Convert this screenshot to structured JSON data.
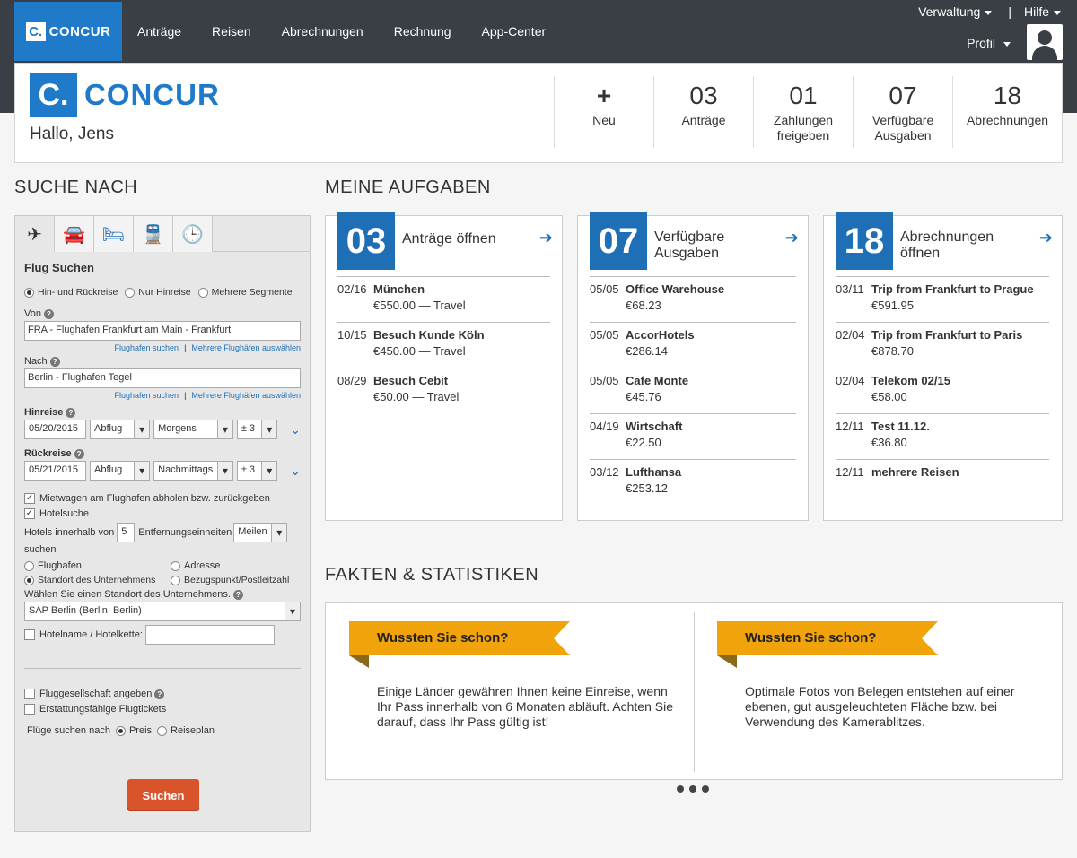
{
  "nav": {
    "logo": "CONCUR",
    "items": [
      "Anträge",
      "Reisen",
      "Abrechnungen",
      "Rechnung",
      "App-Center"
    ],
    "verwaltung": "Verwaltung",
    "sep": "|",
    "hilfe": "Hilfe",
    "profil": "Profil"
  },
  "welcome": {
    "logo": "CONCUR",
    "greeting": "Hallo, Jens",
    "tiles": [
      {
        "num": "+",
        "label": "Neu"
      },
      {
        "num": "03",
        "label": "Anträge"
      },
      {
        "num": "01",
        "label": "Zahlungen freigeben"
      },
      {
        "num": "07",
        "label": "Verfügbare Ausgaben"
      },
      {
        "num": "18",
        "label": "Abrechnungen"
      }
    ]
  },
  "search": {
    "heading": "SUCHE NACH",
    "title": "Flug Suchen",
    "trip_types": [
      "Hin- und Rückreise",
      "Nur Hinreise",
      "Mehrere Segmente"
    ],
    "von_label": "Von",
    "von_value": "FRA - Flughafen Frankfurt am Main - Frankfurt",
    "nach_label": "Nach",
    "nach_value": "Berlin - Flughafen Tegel",
    "link1": "Flughafen suchen",
    "link2": "Mehrere Flughäfen auswählen",
    "hinreise_label": "Hinreise",
    "hin_date": "05/20/2015",
    "hin_type": "Abflug",
    "hin_time": "Morgens",
    "hin_range": "± 3",
    "rueck_label": "Rückreise",
    "rueck_date": "05/21/2015",
    "rueck_type": "Abflug",
    "rueck_time": "Nachmittags",
    "rueck_range": "± 3",
    "car": "Mietwagen am Flughafen abholen bzw. zurückgeben",
    "hotel": "Hotelsuche",
    "hotel_within": "Hotels innerhalb von",
    "hotel_dist": "5",
    "dist_units": "Entfernungseinheiten",
    "dist_unit_val": "Meilen",
    "suchen_word": "suchen",
    "opt_flughafen": "Flughafen",
    "opt_adresse": "Adresse",
    "opt_standort": "Standort des Unternehmens",
    "opt_bezug": "Bezugspunkt/Postleitzahl",
    "standort_label": "Wählen Sie einen Standort des Unternehmens.",
    "standort_value": "SAP Berlin (Berlin, Berlin)",
    "hotelname": "Hotelname / Hotelkette:",
    "airline": "Fluggesellschaft angeben",
    "refund": "Erstattungsfähige Flugtickets",
    "sort_label": "Flüge suchen nach",
    "sort_price": "Preis",
    "sort_plan": "Reiseplan",
    "button": "Suchen"
  },
  "tasks": {
    "heading": "MEINE AUFGABEN",
    "cards": [
      {
        "count": "03",
        "title": "Anträge öffnen",
        "items": [
          {
            "date": "02/16",
            "title": "München",
            "amount": "€550.00 — Travel"
          },
          {
            "date": "10/15",
            "title": "Besuch Kunde Köln",
            "amount": "€450.00 — Travel"
          },
          {
            "date": "08/29",
            "title": "Besuch Cebit",
            "amount": "€50.00 — Travel"
          }
        ]
      },
      {
        "count": "07",
        "title": "Verfügbare Ausgaben",
        "items": [
          {
            "date": "05/05",
            "title": "Office Warehouse",
            "amount": "€68.23"
          },
          {
            "date": "05/05",
            "title": "AccorHotels",
            "amount": "€286.14"
          },
          {
            "date": "05/05",
            "title": "Cafe Monte",
            "amount": "€45.76"
          },
          {
            "date": "04/19",
            "title": "Wirtschaft",
            "amount": "€22.50"
          },
          {
            "date": "03/12",
            "title": "Lufthansa",
            "amount": "€253.12"
          }
        ]
      },
      {
        "count": "18",
        "title": "Abrechnungen öffnen",
        "items": [
          {
            "date": "03/11",
            "title": "Trip from Frankfurt to Prague",
            "amount": "€591.95"
          },
          {
            "date": "02/04",
            "title": "Trip from Frankfurt to Paris",
            "amount": "€878.70"
          },
          {
            "date": "02/04",
            "title": "Telekom 02/15",
            "amount": "€58.00"
          },
          {
            "date": "12/11",
            "title": "Test 11.12.",
            "amount": "€36.80"
          },
          {
            "date": "12/11",
            "title": "mehrere Reisen",
            "amount": ""
          }
        ]
      }
    ]
  },
  "facts": {
    "heading": "FAKTEN & STATISTIKEN",
    "ribbon": "Wussten Sie schon?",
    "text1": "Einige Länder gewähren Ihnen keine Einreise, wenn Ihr Pass innerhalb von 6 Monaten abläuft. Achten Sie darauf, dass Ihr Pass gültig ist!",
    "text2": "Optimale Fotos von Belegen entstehen auf einer ebenen, gut ausgeleuchteten Fläche bzw. bei Verwendung des Kamerablitzes."
  }
}
